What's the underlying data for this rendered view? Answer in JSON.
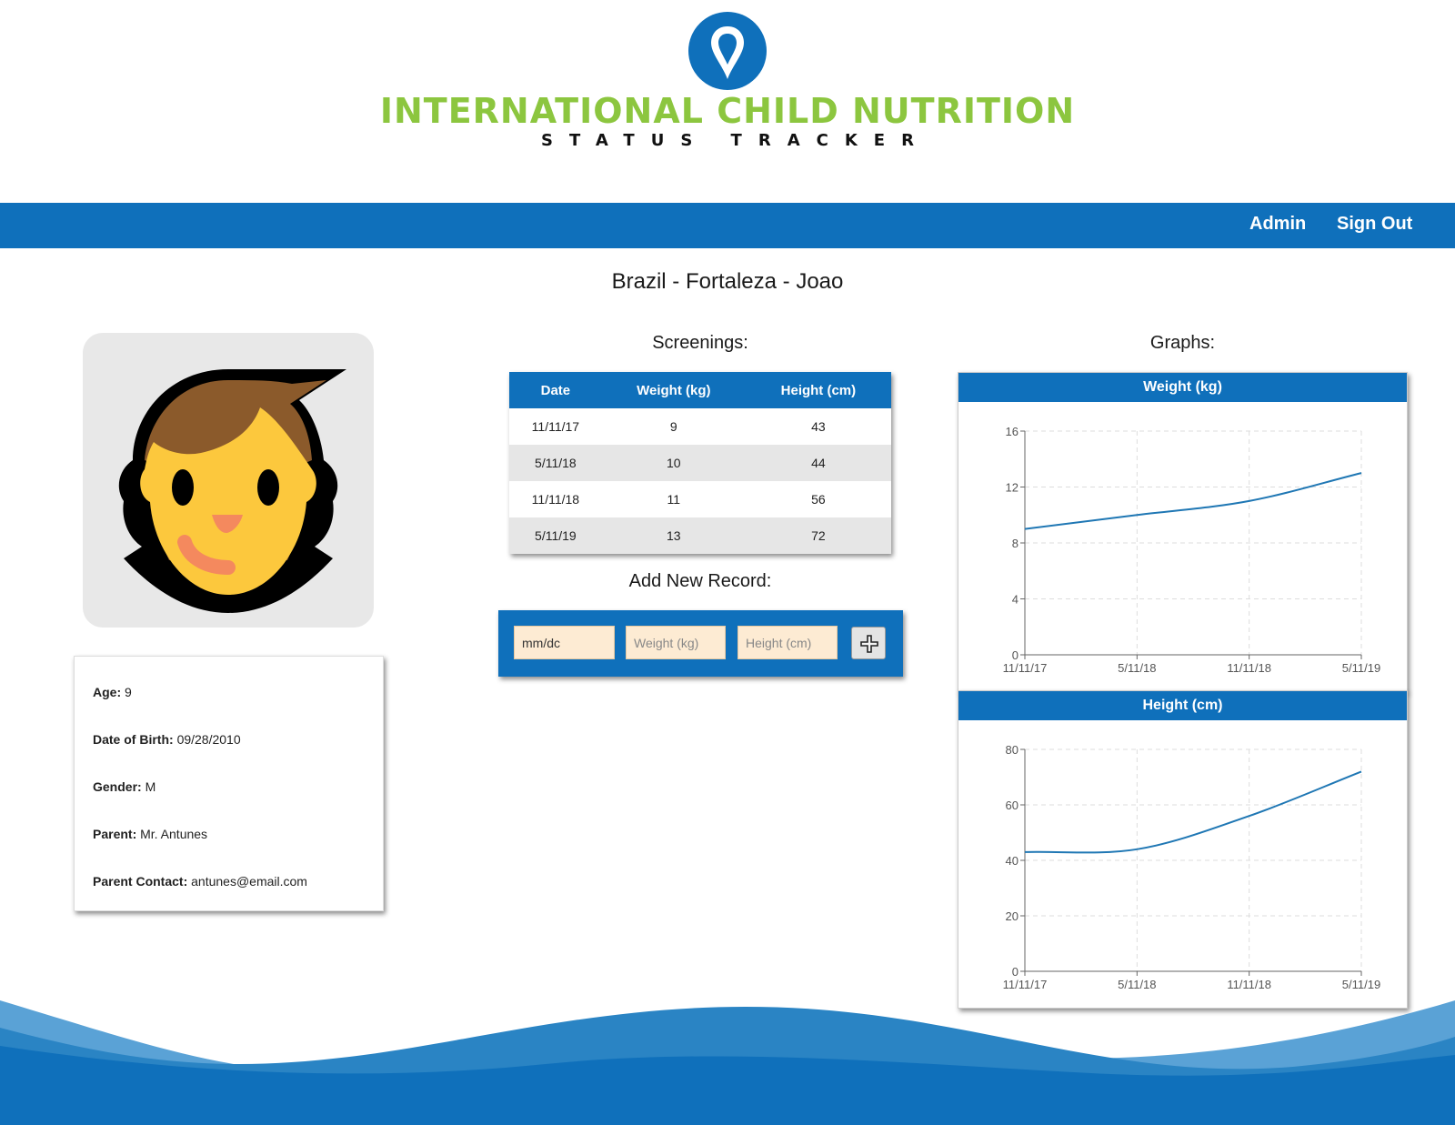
{
  "brand": {
    "title": "INTERNATIONAL CHILD NUTRITION",
    "subtitle": "STATUS TRACKER",
    "icon": "map-pin-icon",
    "colors": {
      "primary": "#0f70bb",
      "accent_green": "#8cc63f"
    }
  },
  "nav": {
    "admin": "Admin",
    "sign_out": "Sign Out"
  },
  "page": {
    "title": "Brazil - Fortaleza - Joao"
  },
  "profile": {
    "avatar_icon": "child-face-icon",
    "age_label": "Age:",
    "age": "9",
    "dob_label": "Date of Birth:",
    "dob": "09/28/2010",
    "gender_label": "Gender:",
    "gender": "M",
    "parent_label": "Parent:",
    "parent": "Mr. Antunes",
    "contact_label": "Parent Contact:",
    "contact": "antunes@email.com"
  },
  "screenings": {
    "heading": "Screenings:",
    "columns": [
      "Date",
      "Weight (kg)",
      "Height (cm)"
    ],
    "rows": [
      [
        "11/11/17",
        "9",
        "43"
      ],
      [
        "5/11/18",
        "10",
        "44"
      ],
      [
        "11/11/18",
        "11",
        "56"
      ],
      [
        "5/11/19",
        "13",
        "72"
      ]
    ]
  },
  "add_record": {
    "heading": "Add New Record:",
    "date_value": "mm/dc",
    "weight_placeholder": "Weight (kg)",
    "height_placeholder": "Height (cm)",
    "add_icon": "plus-icon"
  },
  "graphs": {
    "heading": "Graphs:"
  },
  "chart_data": [
    {
      "type": "line",
      "title": "Weight (kg)",
      "x": [
        "11/11/17",
        "5/11/18",
        "11/11/18",
        "5/11/19"
      ],
      "y": [
        9,
        10,
        11,
        13
      ],
      "x_tick_labels": [
        "11/11/17",
        "5/11/18",
        "11/11/18",
        "5/11/19"
      ],
      "y_ticks": [
        0,
        4,
        8,
        12,
        16
      ],
      "ylim": [
        0,
        16
      ],
      "grid": true,
      "color": "#1f77b4"
    },
    {
      "type": "line",
      "title": "Height (cm)",
      "x": [
        "11/11/17",
        "5/11/18",
        "11/11/18",
        "5/11/19"
      ],
      "y": [
        43,
        44,
        56,
        72
      ],
      "x_tick_labels": [
        "11/11/17",
        "5/11/18",
        "11/11/18",
        "5/11/19"
      ],
      "y_ticks": [
        0,
        20,
        40,
        60,
        80
      ],
      "ylim": [
        0,
        80
      ],
      "grid": true,
      "color": "#1f77b4"
    }
  ]
}
